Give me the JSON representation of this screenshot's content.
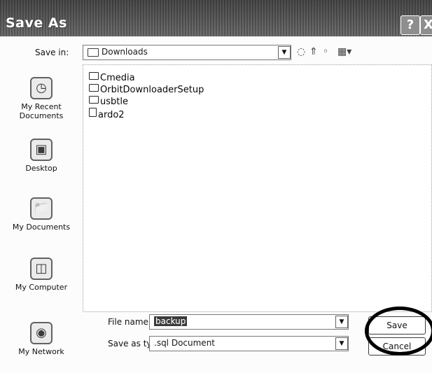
{
  "window": {
    "title": "Save As",
    "help_label": "?",
    "close_label": "X"
  },
  "toolbar": {
    "save_in_label": "Save in:",
    "save_in_value": "Downloads"
  },
  "places": [
    {
      "label_line1": "My Recent",
      "label_line2": "Documents",
      "icon": "recent-documents-icon"
    },
    {
      "label_line1": "Desktop",
      "label_line2": "",
      "icon": "desktop-icon"
    },
    {
      "label_line1": "My Documents",
      "label_line2": "",
      "icon": "my-documents-icon"
    },
    {
      "label_line1": "My Computer",
      "label_line2": "",
      "icon": "my-computer-icon"
    },
    {
      "label_line1": "My Network",
      "label_line2": "",
      "icon": "my-network-icon"
    }
  ],
  "files": [
    {
      "name": "Cmedia",
      "type": "folder"
    },
    {
      "name": "OrbitDownloaderSetup",
      "type": "folder"
    },
    {
      "name": "usbtle",
      "type": "folder"
    },
    {
      "name": "ardo2",
      "type": "file"
    }
  ],
  "form": {
    "file_name_label": "File name:",
    "file_name_value": "backup",
    "save_as_type_label": "Save as type:",
    "save_as_type_value": ".sql Document"
  },
  "buttons": {
    "save": "Save",
    "cancel": "Cancel"
  }
}
